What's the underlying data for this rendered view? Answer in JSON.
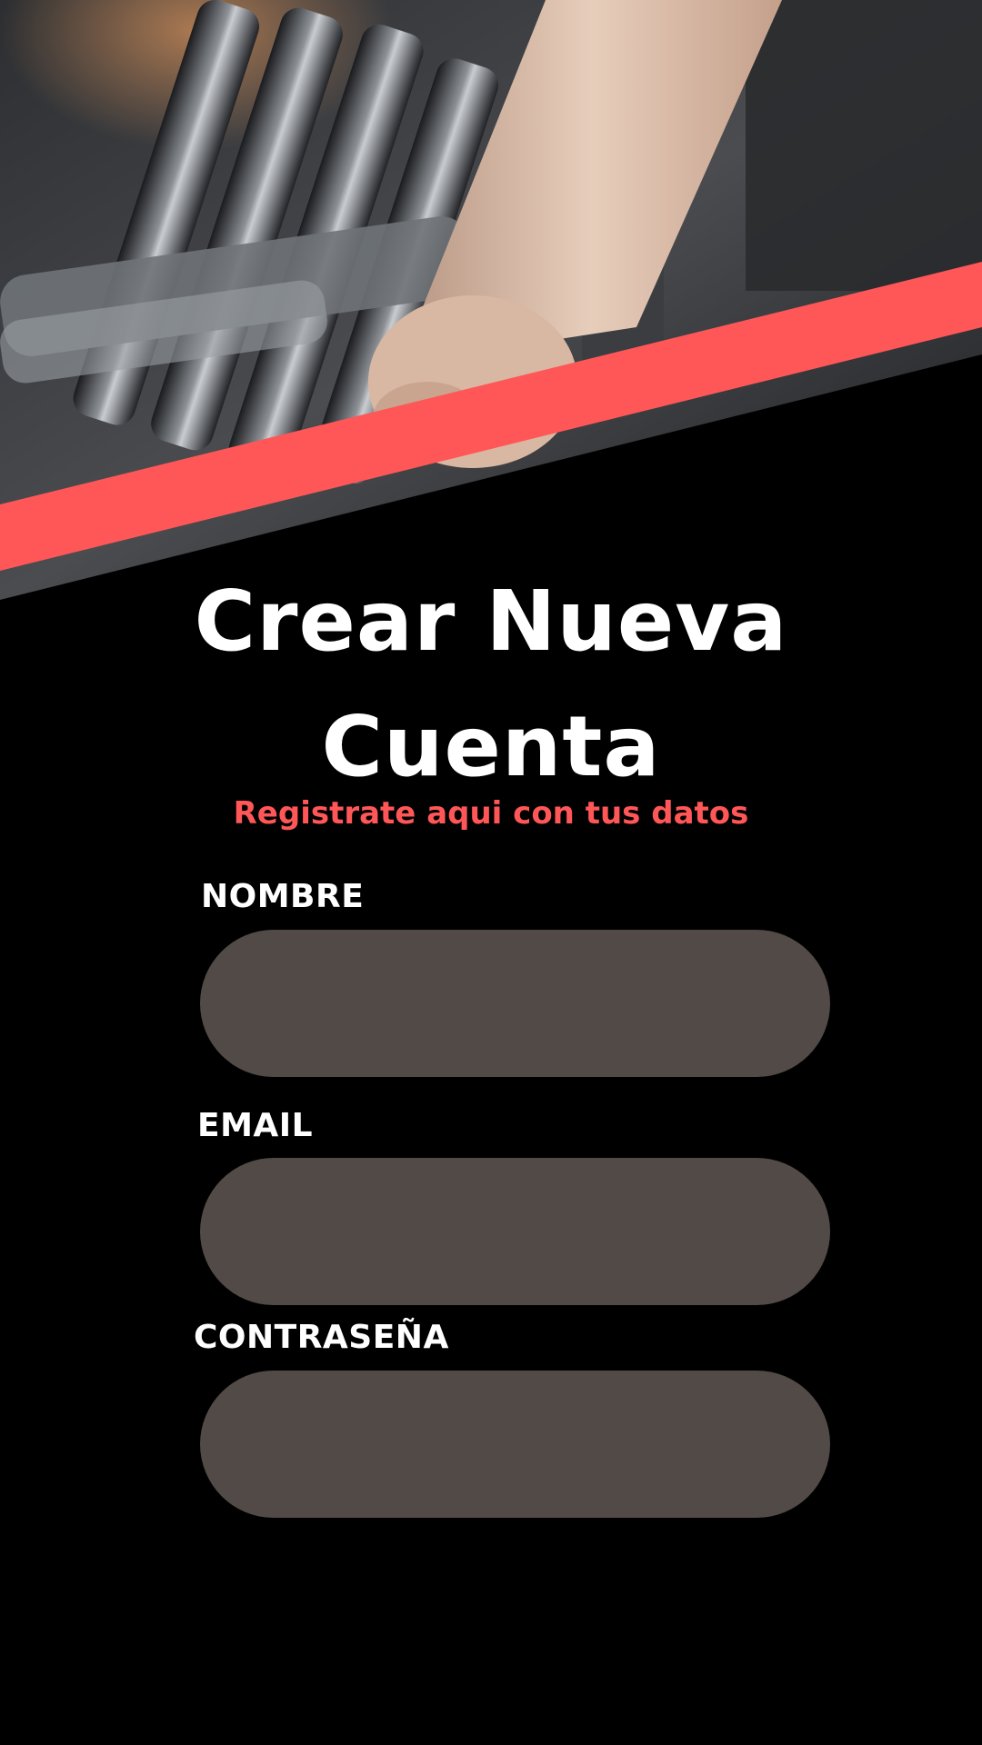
{
  "header": {
    "image": "gym-dumbbell-photo"
  },
  "form": {
    "title_line1": "Crear Nueva",
    "title_line2": "Cuenta",
    "subtitle": "Registrate aqui con tus datos",
    "fields": [
      {
        "label": "NOMBRE",
        "value": ""
      },
      {
        "label": "EMAIL",
        "value": ""
      },
      {
        "label": "CONTRASEÑA",
        "value": ""
      }
    ]
  },
  "colors": {
    "background": "#000000",
    "accent": "#ff5757",
    "input_fill": "#524a46",
    "text": "#ffffff"
  }
}
